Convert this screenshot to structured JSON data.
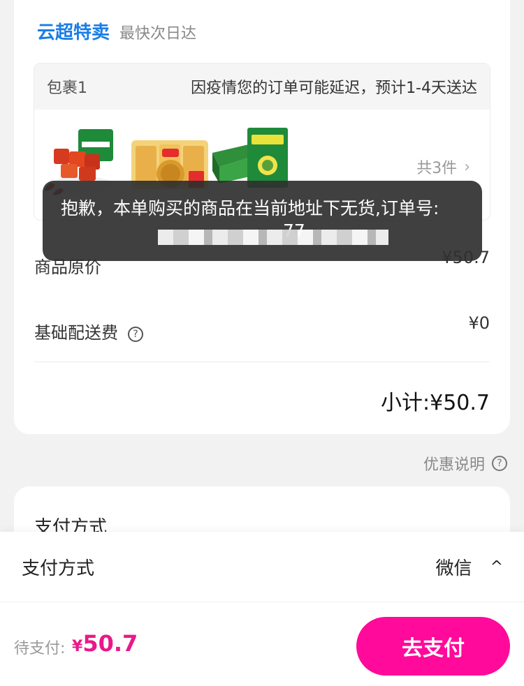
{
  "store": {
    "name": "云超特卖",
    "tag": "最快次日达"
  },
  "package": {
    "label": "包裹1",
    "notice": "因疫情您的订单可能延迟，预计1-4天送达",
    "count": "共3件",
    "chevron": "›",
    "products": [
      {
        "name": "product-spicy-strips"
      },
      {
        "name": "product-noodle-snack"
      },
      {
        "name": "product-green-box-snack"
      }
    ]
  },
  "fees": {
    "original_price_label": "商品原价",
    "original_price": "¥50.7",
    "delivery_label": "基础配送费",
    "delivery": "¥0",
    "help_glyph": "?",
    "subtotal": "小计:¥50.7"
  },
  "promo": {
    "label": "优惠说明",
    "help_glyph": "?"
  },
  "payment_card": {
    "title": "支付方式"
  },
  "sheet": {
    "label": "支付方式",
    "value": "微信",
    "caret": "^"
  },
  "checkout": {
    "due_label": "待支付:",
    "currency": "¥",
    "amount": "50.7",
    "button": "去支付"
  },
  "toast": {
    "message": "抱歉，本单购买的商品在当前地址下无货,订单号:",
    "order_number_visible_suffix": "77"
  },
  "colors": {
    "brand_blue": "#1a7de6",
    "accent_pink": "#ff0a9a",
    "amount_pink": "#e8198b"
  }
}
